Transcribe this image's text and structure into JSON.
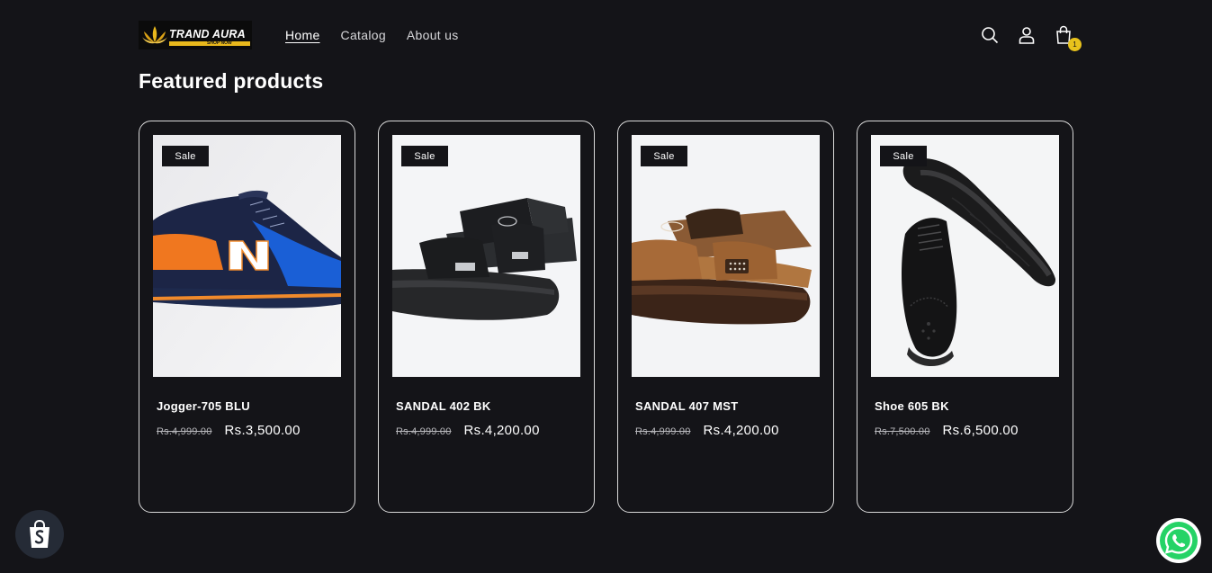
{
  "brand": {
    "name": "TRAND AURA",
    "tagline": "SHOP NOW",
    "accent_color": "#e8b81c"
  },
  "nav": [
    {
      "label": "Home",
      "active": true
    },
    {
      "label": "Catalog",
      "active": false
    },
    {
      "label": "About us",
      "active": false
    }
  ],
  "header_icons": [
    "search-icon",
    "account-icon",
    "cart-icon"
  ],
  "cart": {
    "count": "1"
  },
  "section": {
    "title": "Featured products"
  },
  "products": [
    {
      "badge": "Sale",
      "title": "Jogger-705 BLU",
      "compare_price": "Rs.4,999.00",
      "price": "Rs.3,500.00",
      "image": "blue-orange-sneaker"
    },
    {
      "badge": "Sale",
      "title": "SANDAL 402 BK",
      "compare_price": "Rs.4,999.00",
      "price": "Rs.4,200.00",
      "image": "black-sport-sandal"
    },
    {
      "badge": "Sale",
      "title": "SANDAL 407 MST",
      "compare_price": "Rs.4,999.00",
      "price": "Rs.4,200.00",
      "image": "brown-sport-sandal"
    },
    {
      "badge": "Sale",
      "title": "Shoe 605 BK",
      "compare_price": "Rs.7,500.00",
      "price": "Rs.6,500.00",
      "image": "black-brogue-shoe"
    }
  ],
  "floating": {
    "left": "shopify-bag-icon",
    "right": "whatsapp-icon"
  }
}
